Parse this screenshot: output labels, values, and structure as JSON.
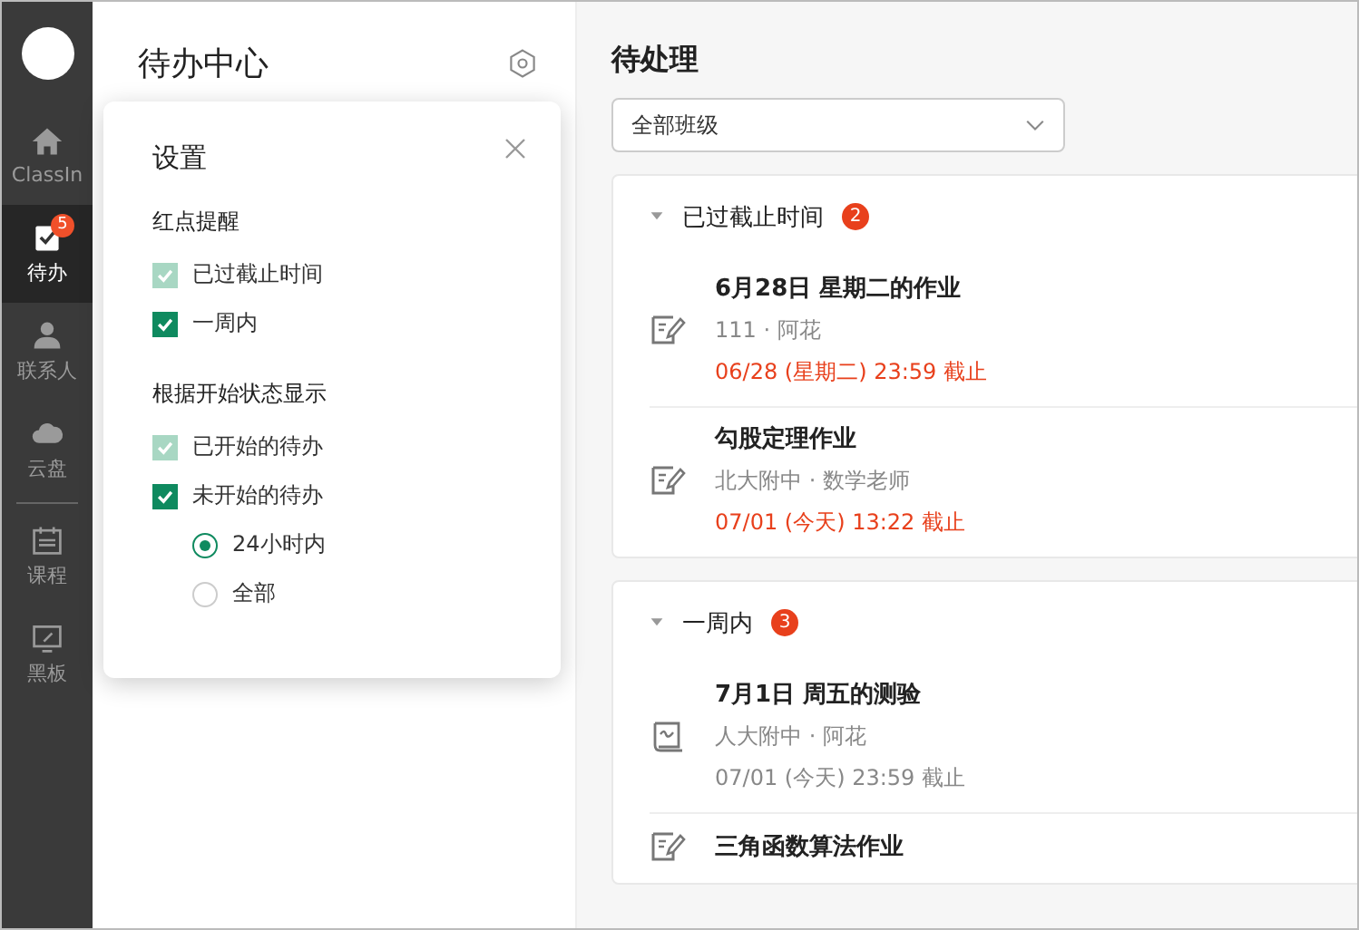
{
  "nav": [
    {
      "label": "ClassIn",
      "selected": false
    },
    {
      "label": "待办",
      "selected": true,
      "badge": "5"
    },
    {
      "label": "联系人",
      "selected": false
    },
    {
      "label": "云盘",
      "selected": false
    },
    {
      "label": "课程",
      "selected": false
    },
    {
      "label": "黑板",
      "selected": false
    }
  ],
  "panel": {
    "title": "待办中心"
  },
  "settings": {
    "title": "设置",
    "groups": [
      {
        "heading": "红点提醒",
        "options": [
          {
            "kind": "checkbox",
            "label": "已过截止时间",
            "checked": true,
            "disabled": true
          },
          {
            "kind": "checkbox",
            "label": "一周内",
            "checked": true,
            "disabled": false
          }
        ]
      },
      {
        "heading": "根据开始状态显示",
        "options": [
          {
            "kind": "checkbox",
            "label": "已开始的待办",
            "checked": true,
            "disabled": true
          },
          {
            "kind": "checkbox",
            "label": "未开始的待办",
            "checked": true,
            "disabled": false
          },
          {
            "kind": "radio",
            "label": "24小时内",
            "selected": true
          },
          {
            "kind": "radio",
            "label": "全部",
            "selected": false
          }
        ]
      }
    ]
  },
  "main": {
    "title": "待处理",
    "filter": {
      "value": "全部班级"
    },
    "sections": [
      {
        "title": "已过截止时间",
        "count": "2",
        "expanded": true,
        "items": [
          {
            "kind": "homework",
            "title": "6月28日 星期二的作业",
            "subtitle": "111 · 阿花",
            "deadline": "06/28 (星期二) 23:59 截止",
            "overdue": true
          },
          {
            "kind": "homework",
            "title": "勾股定理作业",
            "subtitle": "北大附中 · 数学老师",
            "deadline": "07/01 (今天) 13:22 截止",
            "overdue": true
          }
        ]
      },
      {
        "title": "一周内",
        "count": "3",
        "expanded": true,
        "items": [
          {
            "kind": "quiz",
            "title": "7月1日 周五的测验",
            "subtitle": "人大附中 · 阿花",
            "deadline": "07/01 (今天) 23:59 截止",
            "overdue": false
          },
          {
            "kind": "homework",
            "title": "三角函数算法作业"
          }
        ]
      }
    ]
  }
}
